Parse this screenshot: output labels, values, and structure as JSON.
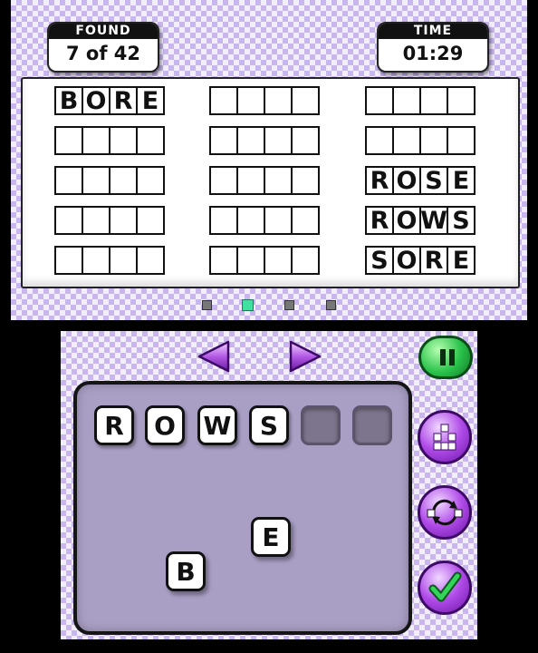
{
  "hud": {
    "found_label": "FOUND",
    "found_value": "7 of 42",
    "time_label": "TIME",
    "time_value": "01:29"
  },
  "words": [
    {
      "letters": [
        "B",
        "O",
        "R",
        "E"
      ]
    },
    {
      "letters": [
        "",
        "",
        "",
        ""
      ]
    },
    {
      "letters": [
        "",
        "",
        "",
        ""
      ]
    },
    {
      "letters": [
        "",
        "",
        "",
        ""
      ]
    },
    {
      "letters": [
        "",
        "",
        "",
        ""
      ]
    },
    {
      "letters": [
        "",
        "",
        "",
        ""
      ]
    },
    {
      "letters": [
        "",
        "",
        "",
        ""
      ]
    },
    {
      "letters": [
        "",
        "",
        "",
        ""
      ]
    },
    {
      "letters": [
        "",
        "",
        "",
        ""
      ]
    },
    {
      "letters": [
        "",
        "",
        "",
        ""
      ]
    },
    {
      "letters": [
        "",
        "",
        "",
        ""
      ]
    },
    {
      "letters": [
        "",
        "",
        "",
        ""
      ]
    },
    {
      "letters": [
        "R",
        "O",
        "S",
        "E"
      ]
    },
    {
      "letters": [
        "R",
        "O",
        "W",
        "S"
      ]
    },
    {
      "letters": [
        "S",
        "O",
        "R",
        "E"
      ]
    }
  ],
  "pagination": {
    "pages": 4,
    "current": 2
  },
  "current_word": {
    "letters": [
      "R",
      "O",
      "W",
      "S"
    ],
    "empty_slots": 2
  },
  "tray_tiles": [
    "E",
    "B"
  ],
  "icons": {
    "prev": "left-arrow-icon",
    "next": "right-arrow-icon",
    "pause": "pause-icon",
    "shuffle_layout": "scatter-icon",
    "swap": "rotate-icon",
    "submit": "checkmark-icon"
  },
  "colors": {
    "checker_light": "#f3eefc",
    "checker_dark": "#c9b6ef",
    "tray": "#a99ec4",
    "accent_green": "#29c24a",
    "accent_purple": "#b04be8",
    "active_page": "#40e0a0"
  }
}
